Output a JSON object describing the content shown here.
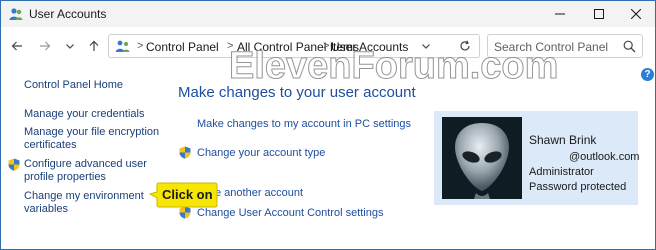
{
  "window": {
    "title": "User Accounts"
  },
  "nav": {
    "breadcrumbs": [
      "Control Panel",
      "All Control Panel Items",
      "User Accounts"
    ],
    "search_placeholder": "Search Control Panel"
  },
  "sidebar": {
    "home": "Control Panel Home",
    "items": [
      {
        "label": "Manage your credentials"
      },
      {
        "label": "Manage your file encryption certificates",
        "lines": [
          "Manage your file encryption",
          "certificates"
        ]
      },
      {
        "label": "Configure advanced user profile properties",
        "lines": [
          "Configure advanced user",
          "profile properties"
        ]
      },
      {
        "label": "Change my environment variables",
        "lines": [
          "Change my environment",
          "variables"
        ]
      }
    ]
  },
  "main": {
    "heading": "Make changes to your user account",
    "links": [
      "Make changes to my account in PC settings",
      "Change your account type",
      "Manage another account",
      "Change User Account Control settings"
    ],
    "links_visible": {
      "manage_another": "e another account"
    }
  },
  "account": {
    "name": "Shawn Brink",
    "email": "@outlook.com",
    "role": "Administrator",
    "protection": "Password protected"
  },
  "watermark": "ElevenForum.com",
  "callout": {
    "text": "Click on",
    "color": "#f7e600"
  },
  "colors": {
    "link": "#1e4fa0",
    "card_background": "#dbe9f8",
    "title_bar": "#f3f3f3"
  }
}
